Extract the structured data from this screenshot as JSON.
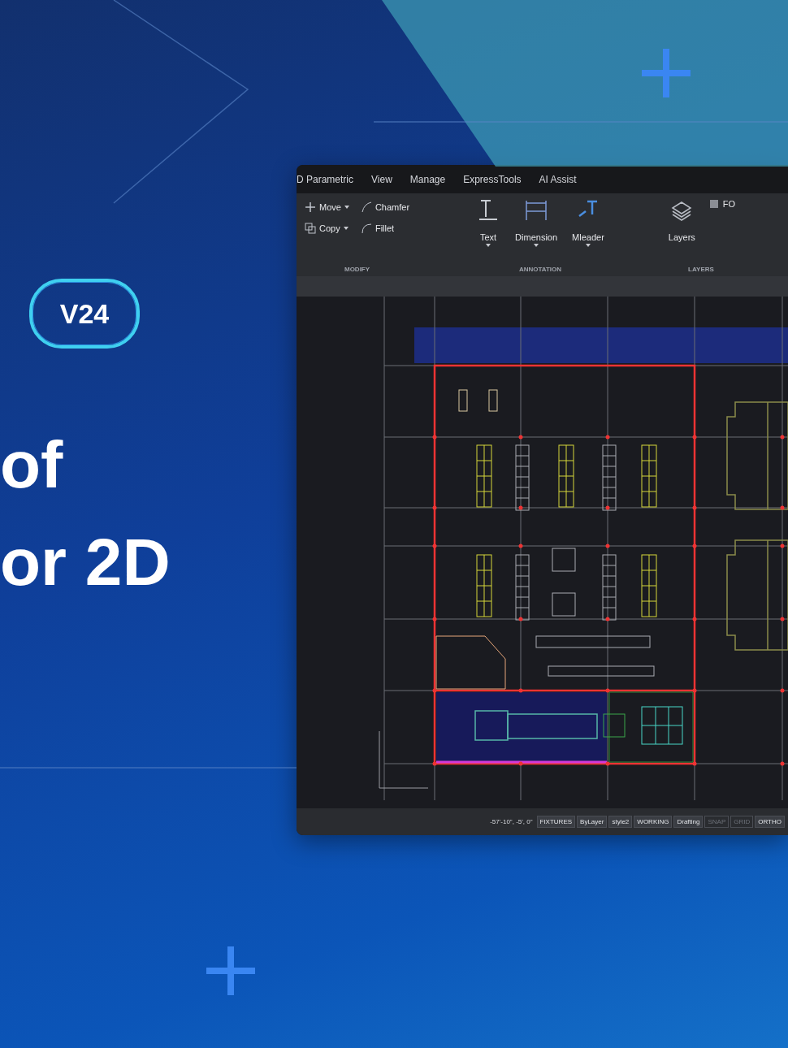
{
  "badge": "V24",
  "headline": [
    "of",
    "or 2D"
  ],
  "app": {
    "menu_tabs": [
      {
        "label": "D Parametric"
      },
      {
        "label": "View"
      },
      {
        "label": "Manage"
      },
      {
        "label": "ExpressTools"
      },
      {
        "label": "AI Assist"
      }
    ],
    "panels": [
      {
        "title": "MODIFY",
        "tools": [
          {
            "kind": "small",
            "label": "Move",
            "dropdown": true
          },
          {
            "kind": "small",
            "label": "Copy",
            "dropdown": true
          },
          {
            "kind": "small",
            "label": "Chamfer",
            "dropdown": false
          },
          {
            "kind": "small",
            "label": "Fillet",
            "dropdown": false
          }
        ]
      },
      {
        "title": "ANNOTATION",
        "tools": [
          {
            "kind": "large",
            "label": "Text",
            "dropdown": true
          },
          {
            "kind": "large",
            "label": "Dimension",
            "dropdown": true
          },
          {
            "kind": "large",
            "label": "Mleader",
            "dropdown": true
          }
        ]
      },
      {
        "title": "LAYERS",
        "tools": [
          {
            "kind": "large",
            "label": "Layers",
            "dropdown": false
          },
          {
            "kind": "small",
            "label": "FO",
            "dropdown": false
          }
        ]
      }
    ],
    "status_bar": {
      "coordinates": "-57'-10\", -5', 0\"",
      "items": [
        {
          "label": "FIXTURES",
          "on": true
        },
        {
          "label": "ByLayer",
          "on": true
        },
        {
          "label": "style2",
          "on": true
        },
        {
          "label": "WORKING",
          "on": true
        },
        {
          "label": "Drafting",
          "on": true
        },
        {
          "label": "SNAP",
          "on": false
        },
        {
          "label": "GRID",
          "on": false
        },
        {
          "label": "ORTHO",
          "on": true
        }
      ]
    }
  }
}
